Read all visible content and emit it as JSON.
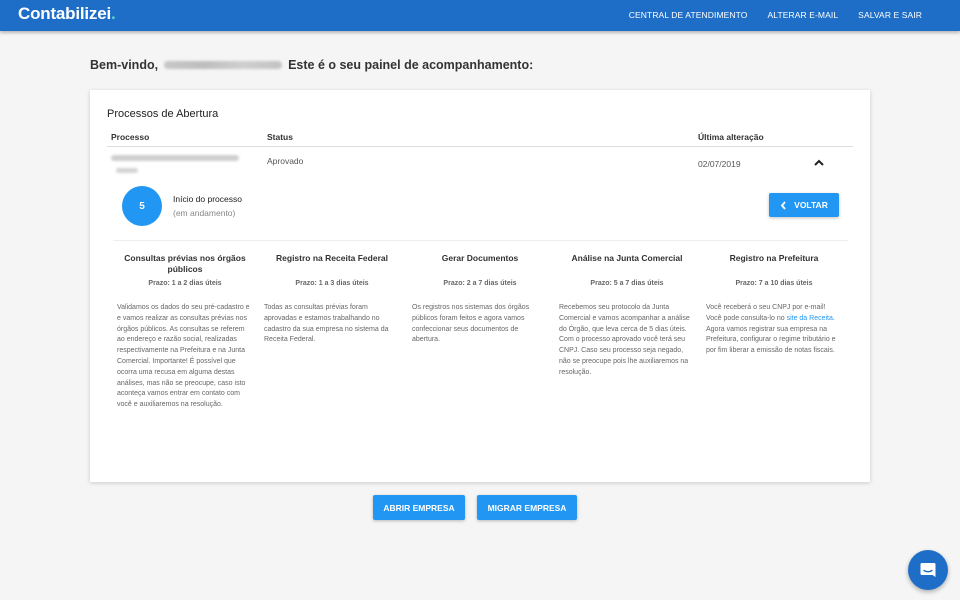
{
  "header": {
    "logo_text": "Contabilizei",
    "logo_dot": ".",
    "nav": [
      "CENTRAL DE ATENDIMENTO",
      "ALTERAR E-MAIL",
      "SALVAR E SAIR"
    ]
  },
  "welcome": {
    "prefix": "Bem-vindo,",
    "suffix": "Este é o seu painel de acompanhamento:"
  },
  "card": {
    "title": "Processos de Abertura",
    "columns": [
      "Processo",
      "Status",
      "Última alteração"
    ],
    "row": {
      "status": "Aprovado",
      "date": "02/07/2019"
    },
    "step": {
      "number": "5",
      "title": "Início do processo",
      "subtitle": "(em andamento)"
    },
    "back_label": "VOLTAR",
    "stages": [
      {
        "title": "Consultas prévias nos órgãos públicos",
        "prazo": "Prazo: 1 a 2 dias úteis",
        "text": "Validamos os dados do seu pré-cadastro e e vamos realizar as consultas prévias nos órgãos públicos. As consultas se referem ao endereço e razão social, realizadas respectivamente na Prefeitura e na Junta Comercial. Importante! É possível que ocorra uma recusa em alguma destas análises, mas não se preocupe, caso isto aconteça vamos entrar em contato com você e auxiliaremos na resolução."
      },
      {
        "title": "Registro na Receita Federal",
        "prazo": "Prazo: 1 a 3 dias úteis",
        "text": "Todas as consultas prévias foram aprovadas e estamos trabalhando no cadastro da sua empresa no sistema da Receita Federal."
      },
      {
        "title": "Gerar Documentos",
        "prazo": "Prazo: 2 a 7 dias úteis",
        "text": "Os registros nos sistemas dos órgãos públicos foram feitos e agora vamos confeccionar seus documentos de abertura."
      },
      {
        "title": "Análise na Junta Comercial",
        "prazo": "Prazo: 5 a 7 dias úteis",
        "text": "Recebemos seu protocolo da Junta Comercial e vamos acompanhar a análise do Órgão, que leva cerca de 5 dias úteis. Com o processo aprovado você terá seu CNPJ. Caso seu processo seja negado, não se preocupe pois lhe auxiliaremos na resolução."
      },
      {
        "title": "Registro na Prefeitura",
        "prazo": "Prazo: 7 a 10 dias úteis",
        "text_1": "Você receberá o seu CNPJ por e-mail! Você pode consulta-lo no",
        "link": "site da Receita",
        "text_2": ".",
        "text_3": "Agora vamos registrar sua empresa na Prefeitura, configurar o regime tributário e por fim liberar a emissão de notas fiscais."
      }
    ]
  },
  "actions": {
    "open": "ABRIR EMPRESA",
    "migrate": "MIGRAR EMPRESA"
  },
  "icons": {
    "chat": "chat-bubble-icon",
    "chevron_up": "chevron-up-icon",
    "chevron_left": "chevron-left-icon"
  },
  "colors": {
    "brand": "#1e6ec8",
    "accent": "#2196f3",
    "logo_dot": "#5fd3c8"
  }
}
